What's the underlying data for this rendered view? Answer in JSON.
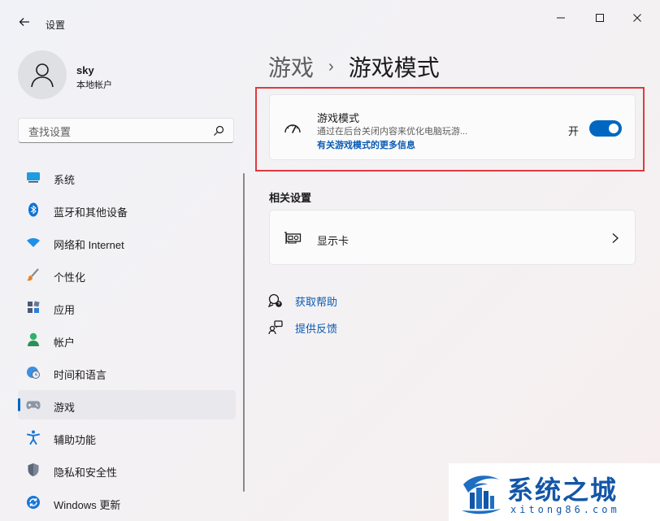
{
  "window": {
    "title": "设置"
  },
  "user": {
    "name": "sky",
    "account_type": "本地帐户"
  },
  "search": {
    "placeholder": "查找设置"
  },
  "sidebar": {
    "items": [
      {
        "label": "系统",
        "icon": "system-icon"
      },
      {
        "label": "蓝牙和其他设备",
        "icon": "bluetooth-icon"
      },
      {
        "label": "网络和 Internet",
        "icon": "wifi-icon"
      },
      {
        "label": "个性化",
        "icon": "brush-icon"
      },
      {
        "label": "应用",
        "icon": "apps-icon"
      },
      {
        "label": "帐户",
        "icon": "person-icon"
      },
      {
        "label": "时间和语言",
        "icon": "globe-clock-icon"
      },
      {
        "label": "游戏",
        "icon": "gamepad-icon"
      },
      {
        "label": "辅助功能",
        "icon": "accessibility-icon"
      },
      {
        "label": "隐私和安全性",
        "icon": "shield-icon"
      },
      {
        "label": "Windows 更新",
        "icon": "update-icon"
      }
    ],
    "active_index": 7
  },
  "breadcrumb": {
    "parent": "游戏",
    "separator": "›",
    "current": "游戏模式"
  },
  "game_mode": {
    "title": "游戏模式",
    "description": "通过在后台关闭内容来优化电脑玩游...",
    "link": "有关游戏模式的更多信息",
    "state_label": "开",
    "enabled": true
  },
  "related": {
    "heading": "相关设置",
    "graphics_label": "显示卡"
  },
  "help": {
    "get_help": "获取帮助",
    "feedback": "提供反馈"
  },
  "watermark": {
    "title": "系统之城",
    "url": "xitong86.com"
  },
  "colors": {
    "accent": "#0067c0",
    "highlight_border": "#e0393e",
    "link": "#0a5bb3",
    "watermark": "#1356a8"
  }
}
